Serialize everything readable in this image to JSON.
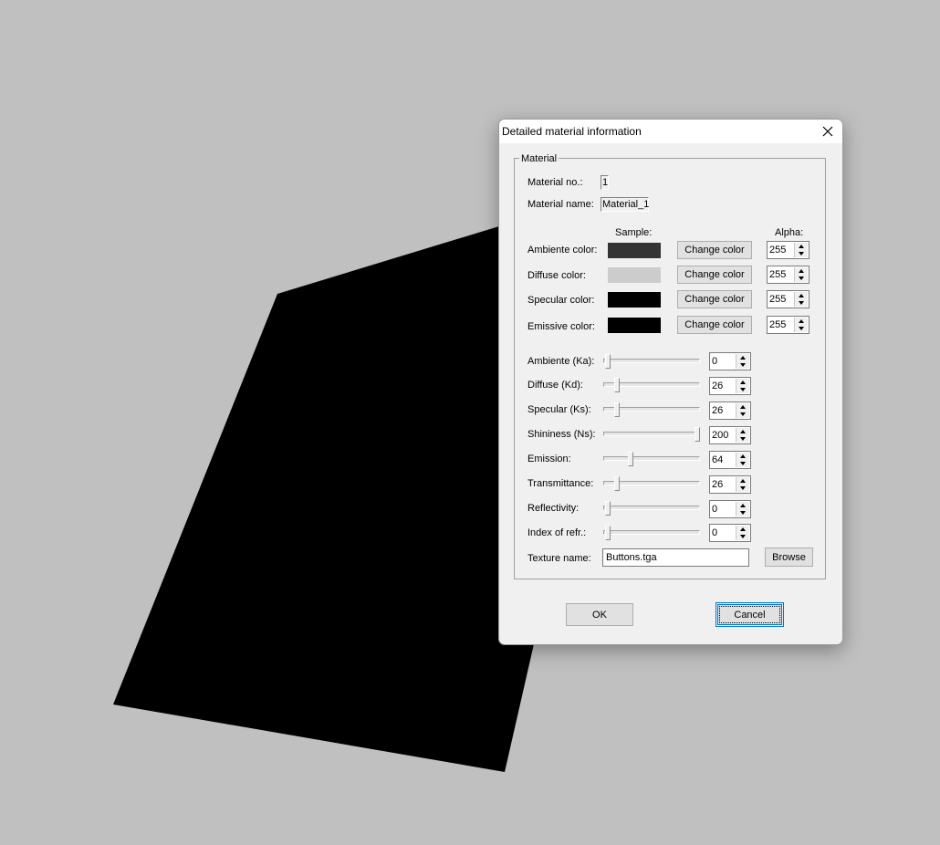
{
  "dialog": {
    "title": "Detailed material information",
    "group_label": "Material",
    "material_no_label": "Material no.:",
    "material_no": "1",
    "material_name_label": "Material name:",
    "material_name": "Material_1",
    "sample_header": "Sample:",
    "alpha_header": "Alpha:",
    "colors": [
      {
        "label": "Ambiente color:",
        "swatch": "#343434",
        "button": "Change color",
        "alpha": "255"
      },
      {
        "label": "Diffuse color:",
        "swatch": "#cccccc",
        "button": "Change color",
        "alpha": "255"
      },
      {
        "label": "Specular color:",
        "swatch": "#000000",
        "button": "Change color",
        "alpha": "255"
      },
      {
        "label": "Emissive color:",
        "swatch": "#000000",
        "button": "Change color",
        "alpha": "255"
      }
    ],
    "sliders": [
      {
        "label": "Ambiente (Ka):",
        "value": "0",
        "level": 0
      },
      {
        "label": "Diffuse (Kd):",
        "value": "26",
        "level": 0.1
      },
      {
        "label": "Specular (Ks):",
        "value": "26",
        "level": 0.1
      },
      {
        "label": "Shininess (Ns):",
        "value": "200",
        "level": 1
      },
      {
        "label": "Emission:",
        "value": "64",
        "level": 0.25
      },
      {
        "label": "Transmittance:",
        "value": "26",
        "level": 0.1
      },
      {
        "label": "Reflectivity:",
        "value": "0",
        "level": 0
      },
      {
        "label": "Index of refr.:",
        "value": "0",
        "level": 0
      }
    ],
    "texture_label": "Texture name:",
    "texture_value": "Buttons.tga",
    "browse_label": "Browse",
    "ok_label": "OK",
    "cancel_label": "Cancel"
  },
  "scene": {
    "background": "#c0c0c0",
    "object_color": "#000000"
  }
}
